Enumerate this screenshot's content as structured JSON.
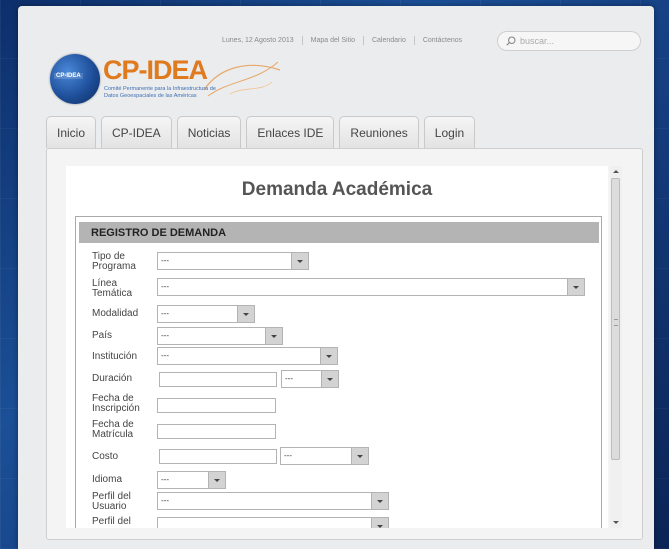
{
  "header": {
    "date": "Lunes, 12 Agosto 2013",
    "links": [
      "Mapa del Sitio",
      "Calendario",
      "Contáctenos"
    ],
    "search_placeholder": "buscar..."
  },
  "logo": {
    "globe_label": "CP-IDEA",
    "title": "CP-IDEA",
    "subtitle_line1": "Comité Permanente para la Infraestructura de",
    "subtitle_line2": "Datos Geoespaciales de las Américas"
  },
  "tabs": [
    "Inicio",
    "CP-IDEA",
    "Noticias",
    "Enlaces IDE",
    "Reuniones",
    "Login"
  ],
  "page": {
    "title": "Demanda Académica",
    "section_title": "REGISTRO DE DEMANDA"
  },
  "form": {
    "fields": [
      {
        "label": "Tipo de Programa",
        "type": "select",
        "value": "---"
      },
      {
        "label": "Línea Temática",
        "type": "select",
        "value": "---"
      },
      {
        "label": "Modalidad",
        "type": "select",
        "value": "---"
      },
      {
        "label": "País",
        "type": "select",
        "value": "---"
      },
      {
        "label": "Institución",
        "type": "select",
        "value": "---"
      },
      {
        "label": "Duración",
        "type": "text+select",
        "value": "",
        "unit_value": "---"
      },
      {
        "label": "Fecha de Inscripción",
        "type": "text",
        "value": ""
      },
      {
        "label": "Fecha de Matrícula",
        "type": "text",
        "value": ""
      },
      {
        "label": "Costo",
        "type": "text+select",
        "value": "",
        "unit_value": "---"
      },
      {
        "label": "Idioma",
        "type": "select",
        "value": "---"
      },
      {
        "label": "Perfil del Usuario",
        "type": "select",
        "value": "---"
      },
      {
        "label": "Perfil del",
        "type": "select",
        "value": ""
      }
    ]
  },
  "colors": {
    "background": "#163f82",
    "logo_orange": "#e07a1f",
    "section_header": "#b4b4b4"
  }
}
